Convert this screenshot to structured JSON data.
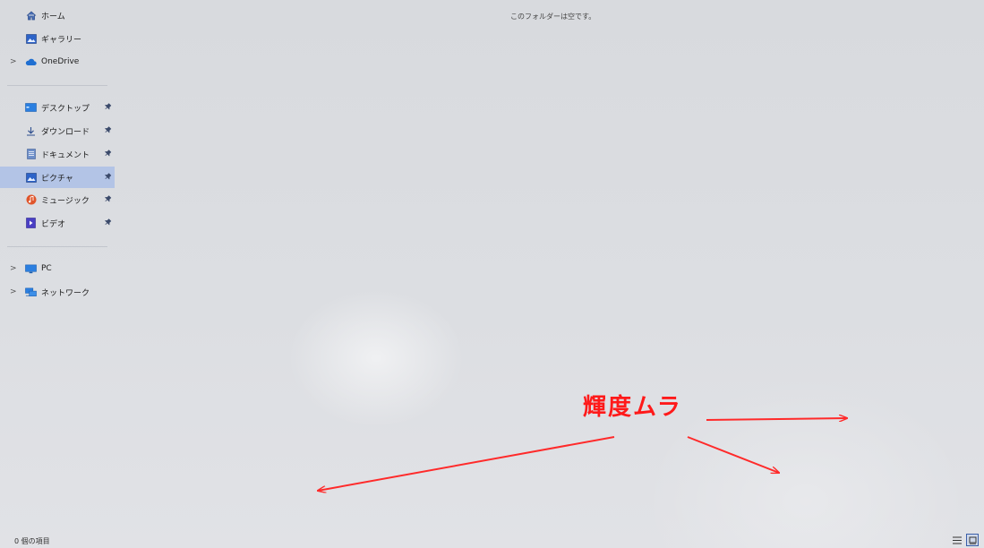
{
  "sidebar": {
    "items": [
      {
        "label": "ホーム",
        "icon": "home-icon",
        "pinned": false,
        "chevron": false
      },
      {
        "label": "ギャラリー",
        "icon": "gallery-icon",
        "pinned": false,
        "chevron": false
      },
      {
        "label": "OneDrive",
        "icon": "cloud-icon",
        "pinned": false,
        "chevron": true
      },
      {
        "label": "デスクトップ",
        "icon": "desktop-icon",
        "pinned": true,
        "chevron": false
      },
      {
        "label": "ダウンロード",
        "icon": "download-icon",
        "pinned": true,
        "chevron": false
      },
      {
        "label": "ドキュメント",
        "icon": "document-icon",
        "pinned": true,
        "chevron": false
      },
      {
        "label": "ピクチャ",
        "icon": "pictures-icon",
        "pinned": true,
        "chevron": false,
        "selected": true
      },
      {
        "label": "ミュージック",
        "icon": "music-icon",
        "pinned": true,
        "chevron": false
      },
      {
        "label": "ビデオ",
        "icon": "video-icon",
        "pinned": true,
        "chevron": false
      },
      {
        "label": "PC",
        "icon": "pc-icon",
        "pinned": false,
        "chevron": true
      },
      {
        "label": "ネットワーク",
        "icon": "network-icon",
        "pinned": false,
        "chevron": true
      }
    ],
    "chevron_glyph": ">",
    "pin_glyph": "📌"
  },
  "main": {
    "empty_message": "このフォルダーは空です。"
  },
  "status": {
    "item_count": "0 個の項目"
  },
  "annotation": {
    "label": "輝度ムラ",
    "color": "#ff1a1a"
  },
  "colors": {
    "selected_bg": "#b3c4e6",
    "accent": "#3a5fa8"
  }
}
